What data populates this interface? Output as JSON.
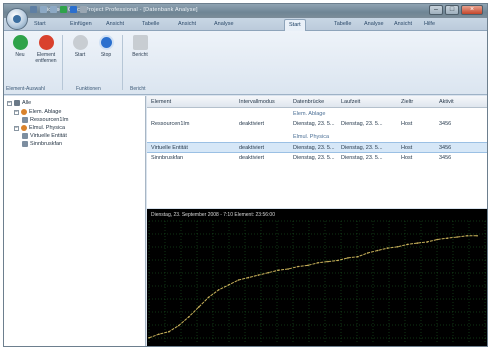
{
  "window": {
    "title": "Microsoft Office Project Professional - [Datenbank Analyse]",
    "min": "–",
    "max": "□",
    "close": "×"
  },
  "tabs": [
    "Start",
    "Einfügen",
    "Ansicht",
    "Tabelle",
    "Ansicht",
    "Analyse",
    "Start",
    "Tabelle",
    "Analyse",
    "Ansicht",
    "Hilfe"
  ],
  "active_tab_index": 6,
  "ribbon": {
    "buttons": [
      {
        "label": "Neu"
      },
      {
        "label": "Element entfernen"
      },
      {
        "label": "Start"
      },
      {
        "label": "Stop"
      },
      {
        "label": "Bericht"
      }
    ],
    "groups": [
      "Element-Auswahl",
      "Funktionen",
      "Bericht"
    ],
    "colors": {
      "green": "#2fa34a",
      "red": "#d9412d",
      "blue": "#2a6fce",
      "gray": "#c8cdd2"
    }
  },
  "tree": {
    "nodes": [
      {
        "label": "Alle",
        "icon": "folder-icon",
        "color": "#6b7a88"
      },
      {
        "label": "Elem. Ablage",
        "icon": "flag-icon",
        "color": "#d9822b"
      },
      {
        "label": "Ressourcen1Im",
        "icon": "doc-icon",
        "color": "#7d8ea0"
      },
      {
        "label": "Elmul. Physica",
        "icon": "flag-icon",
        "color": "#d9822b"
      },
      {
        "label": "Virtuelle Entität",
        "icon": "doc-icon",
        "color": "#7d8ea0"
      },
      {
        "label": "Sinnbruskfan",
        "icon": "doc-icon",
        "color": "#7d8ea0"
      }
    ]
  },
  "grid": {
    "headers": [
      "Element",
      "Intervallmodus",
      "Datenbrücke",
      "Laufzeit",
      "Zieltr",
      "Aktivit"
    ],
    "rows": [
      {
        "type": "group",
        "cells": [
          "",
          "",
          "Elem. Ablage",
          "",
          "",
          ""
        ]
      },
      {
        "type": "data",
        "cells": [
          "Ressourcen1Im",
          "deaktiviert",
          "Dienstag, 23. 5...",
          "Dienstag, 23. 5...",
          "Host",
          "3456"
        ]
      },
      {
        "type": "group",
        "cells": [
          "",
          "",
          "Elmul. Physica",
          "",
          "",
          ""
        ]
      },
      {
        "type": "sel",
        "cells": [
          "Virtuelle Entität",
          "deaktiviert",
          "Dienstag, 23. 5...",
          "Dienstag, 23. 5...",
          "Host",
          "3456"
        ]
      },
      {
        "type": "data",
        "cells": [
          "Sinnbruskfan",
          "deaktiviert",
          "Dienstag, 23. 5...",
          "Dienstag, 23. 5...",
          "Host",
          "3456"
        ]
      }
    ]
  },
  "chart_data": {
    "type": "line",
    "title": "Dienstag, 23. September 2008 - 7:10 Element: 23:56:00",
    "x": [
      0,
      10,
      20,
      30,
      40,
      50,
      60,
      70,
      80,
      90,
      100,
      110,
      120,
      130,
      140,
      150,
      160,
      170,
      180,
      190,
      200,
      210,
      220,
      230,
      240,
      250,
      260,
      270,
      280,
      290,
      300,
      310,
      320,
      330
    ],
    "series": [
      {
        "values": [
          5,
          8,
          10,
          15,
          22,
          30,
          38,
          44,
          48,
          52,
          54,
          56,
          58,
          60,
          61,
          63,
          64,
          66,
          67,
          68,
          70,
          71,
          74,
          76,
          78,
          79,
          81,
          82,
          83,
          85,
          86,
          87,
          88,
          88
        ],
        "color": "#c9b25a"
      }
    ],
    "ylim": [
      0,
      100
    ],
    "xlim": [
      0,
      340
    ],
    "grid": true,
    "grid_color": "#1f6b2a",
    "background": "#000000"
  }
}
